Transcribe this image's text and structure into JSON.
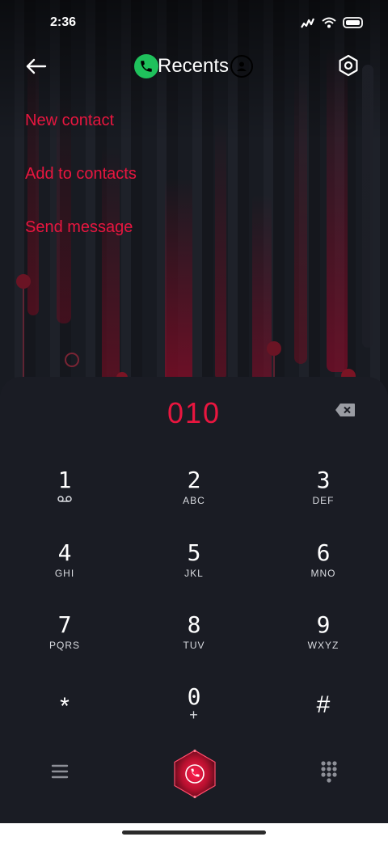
{
  "status": {
    "time": "2:36",
    "icons": [
      "signal-icon",
      "wifi-icon",
      "battery-icon"
    ]
  },
  "header": {
    "title": "Recents",
    "back_icon": "arrow-left-icon",
    "settings_icon": "settings-hexagon-icon",
    "phone_badge_icon": "phone-icon",
    "contact_icon": "contact-icon"
  },
  "menu": {
    "items": [
      {
        "label": "New contact"
      },
      {
        "label": "Add to contacts"
      },
      {
        "label": "Send message"
      }
    ]
  },
  "dialer": {
    "number": "010",
    "keys": [
      {
        "digit": "1",
        "sub": "voicemail-icon"
      },
      {
        "digit": "2",
        "sub": "ABC"
      },
      {
        "digit": "3",
        "sub": "DEF"
      },
      {
        "digit": "4",
        "sub": "GHI"
      },
      {
        "digit": "5",
        "sub": "JKL"
      },
      {
        "digit": "6",
        "sub": "MNO"
      },
      {
        "digit": "7",
        "sub": "PQRS"
      },
      {
        "digit": "8",
        "sub": "TUV"
      },
      {
        "digit": "9",
        "sub": "WXYZ"
      },
      {
        "digit": "*",
        "sub": ""
      },
      {
        "digit": "0",
        "sub": "+"
      },
      {
        "digit": "#",
        "sub": ""
      }
    ]
  },
  "colors": {
    "accent": "#e8163f",
    "call_green": "#1fc15c",
    "pad_background": "#1a1c24"
  }
}
